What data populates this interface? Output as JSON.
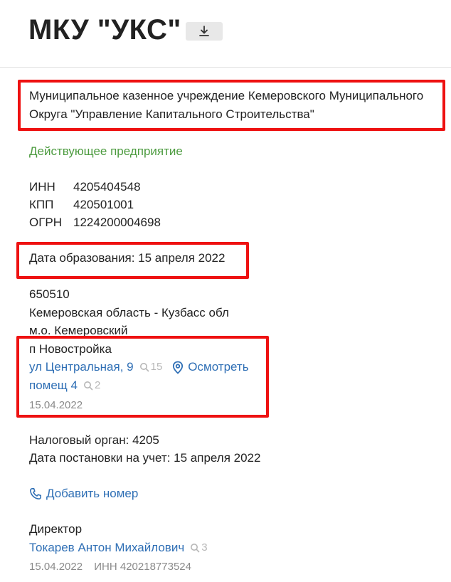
{
  "header": {
    "title": "МКУ \"УКС\"",
    "download_icon": "download-icon"
  },
  "company": {
    "full_name": "Муниципальное казенное учреждение Кемеровского Муниципального Округа \"Управление Капитального Строительства\"",
    "status": "Действующее предприятие"
  },
  "ids": [
    {
      "key": "ИНН",
      "value": "4205404548"
    },
    {
      "key": "КПП",
      "value": "420501001"
    },
    {
      "key": "ОГРН",
      "value": "1224200004698"
    }
  ],
  "founded": "Дата образования: 15 апреля 2022",
  "address": {
    "postcode": "650510",
    "region": "Кемеровская область - Кузбасс обл",
    "district": "м.о. Кемеровский",
    "settlement": "п Новостройка",
    "street": "ул Центральная, 9",
    "street_count": "15",
    "view_label": "Осмотреть",
    "premises": "помещ 4",
    "premises_count": "2",
    "date": "15.04.2022"
  },
  "tax": {
    "organ": "Налоговый орган: 4205",
    "registration": "Дата постановки на учет: 15 апреля 2022"
  },
  "phone": {
    "add_label": "Добавить номер"
  },
  "director": {
    "role": "Директор",
    "name": "Токарев Антон Михайлович",
    "count": "3",
    "date": "15.04.2022",
    "inn": "ИНН 420218773524"
  },
  "colors": {
    "link": "#2f6fb5",
    "status": "#4c9b3f",
    "highlight": "#ee1111"
  }
}
